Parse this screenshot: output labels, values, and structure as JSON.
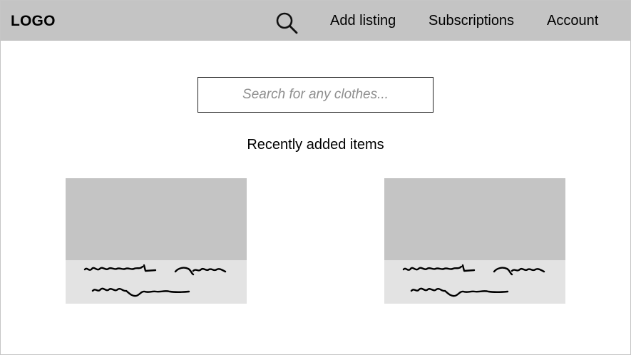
{
  "header": {
    "logo": "LOGO",
    "search_icon": "search-icon",
    "nav": {
      "add_listing": "Add listing",
      "subscriptions": "Subscriptions",
      "account": "Account"
    }
  },
  "main": {
    "search": {
      "placeholder": "Search for any clothes...",
      "value": ""
    },
    "section_title": "Recently added items",
    "cards": [
      {
        "image": "placeholder-image",
        "caption": "squiggle-placeholder-text"
      },
      {
        "image": "placeholder-image",
        "caption": "squiggle-placeholder-text"
      }
    ]
  },
  "colors": {
    "topbar": "#c4c4c4",
    "card_image": "#c4c4c4",
    "card_caption": "#e3e3e3",
    "placeholder_text": "#8e8e8e"
  }
}
